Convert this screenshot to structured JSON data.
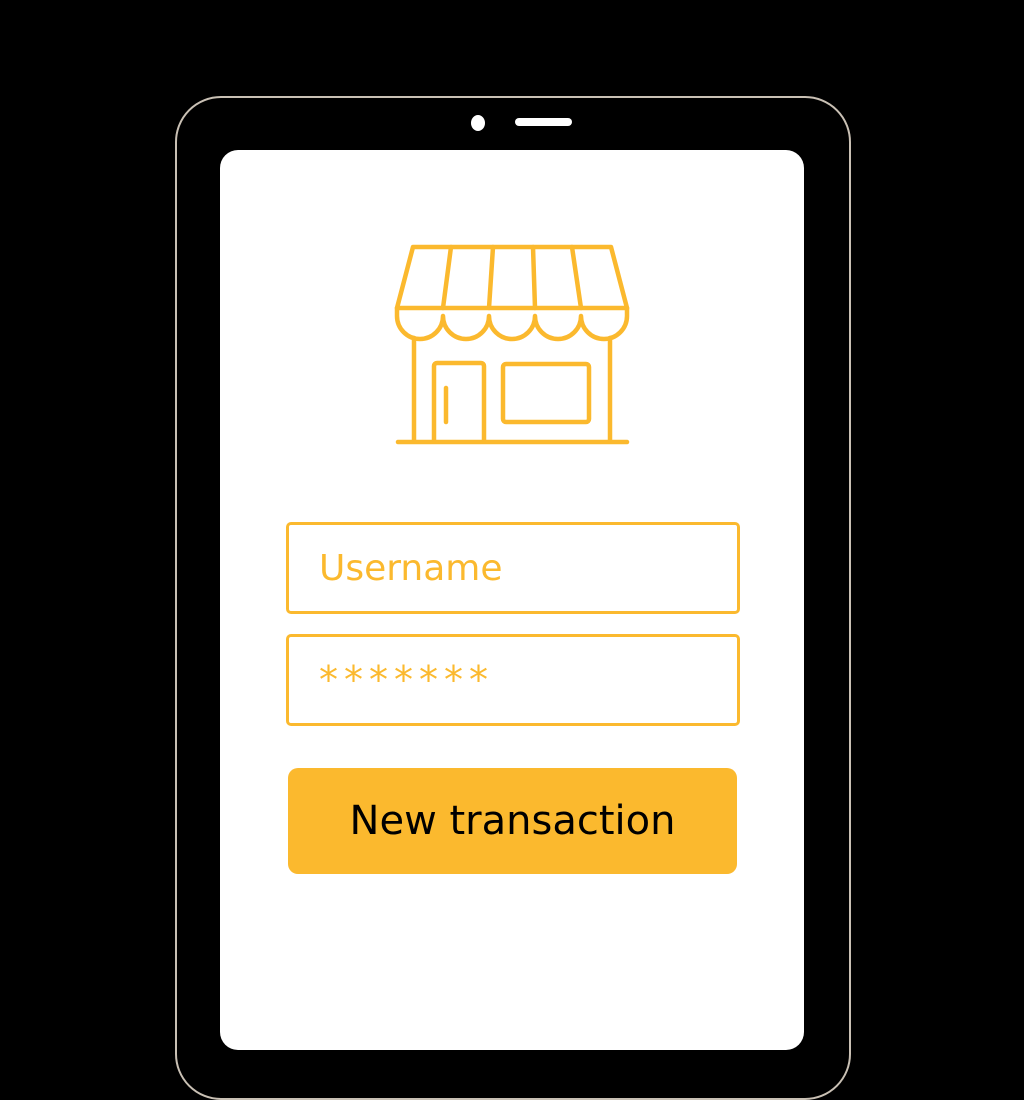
{
  "login": {
    "username_placeholder": "Username",
    "password_value": "*******",
    "submit_label": "New transaction"
  },
  "icons": {
    "logo": "storefront-icon"
  },
  "colors": {
    "accent": "#fbb92e",
    "background": "#000000",
    "screen": "#ffffff",
    "bezel_outline": "#c9c0b4"
  }
}
